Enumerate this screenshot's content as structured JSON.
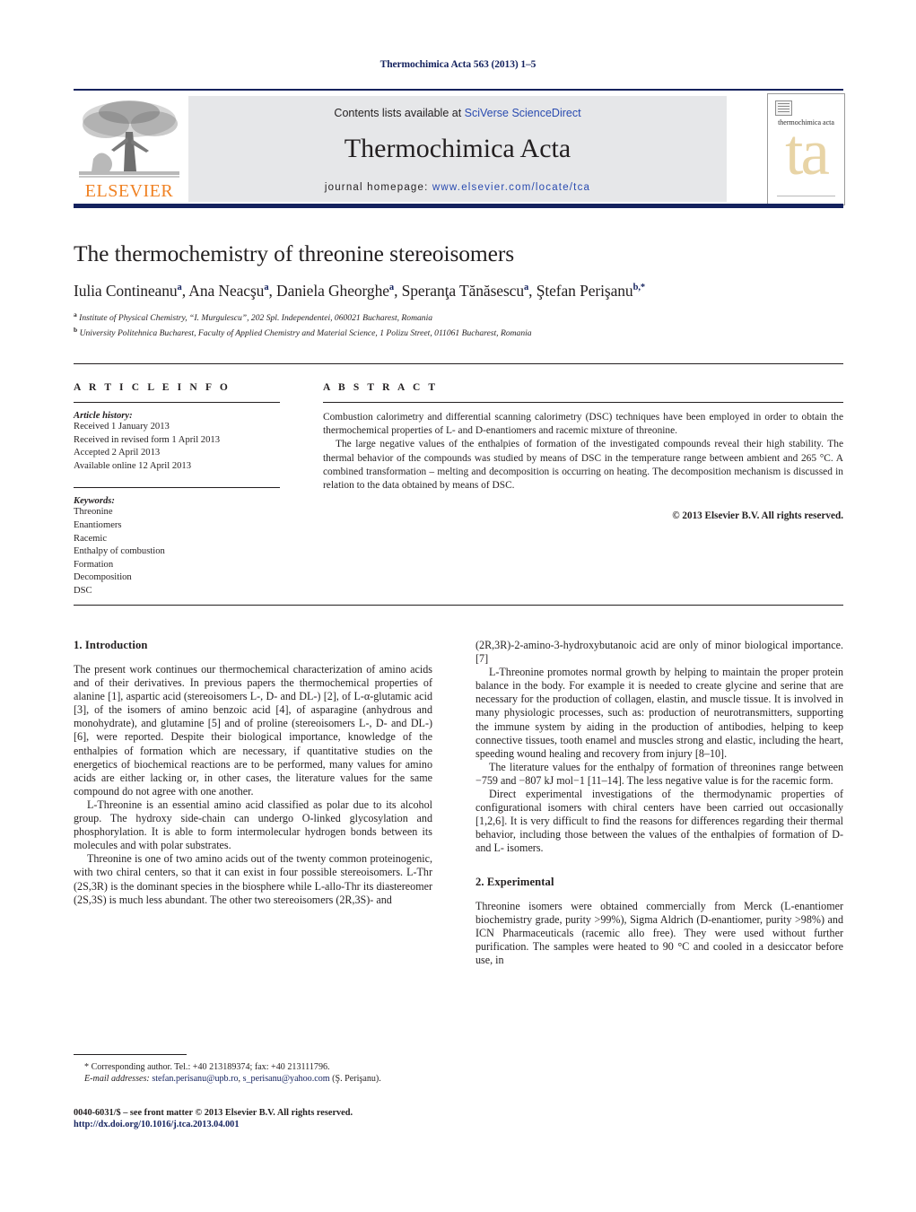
{
  "running_head": "Thermochimica Acta 563 (2013) 1–5",
  "masthead": {
    "contents_prefix": "Contents lists available at ",
    "sciencedirect_link": "SciVerse ScienceDirect",
    "journal_title": "Thermochimica Acta",
    "homepage_prefix": "journal homepage: ",
    "homepage_url": "www.elsevier.com/locate/tca",
    "publisher_logo_text": "ELSEVIER",
    "cover_journal_name": "thermochimica acta",
    "cover_monogram": "ta",
    "accent_link_color": "#2a4bb0",
    "brand_orange": "#f08224",
    "rule_navy": "#14225e"
  },
  "article": {
    "title": "The thermochemistry of threonine stereoisomers",
    "authors": [
      {
        "name": "Iulia Contineanu",
        "marks": "a",
        "sep": ", "
      },
      {
        "name": "Ana Neacşu",
        "marks": "a",
        "sep": ", "
      },
      {
        "name": "Daniela Gheorghe",
        "marks": "a",
        "sep": ", "
      },
      {
        "name": "Speranţa Tănăsescu",
        "marks": "a",
        "sep": ", "
      },
      {
        "name": "Ştefan Perişanu",
        "marks": "b,",
        "sep": ""
      }
    ],
    "affiliations": [
      {
        "mark": "a",
        "text": "Institute of Physical Chemistry, “I. Murgulescu”, 202 Spl. Independentei, 060021 Bucharest, Romania"
      },
      {
        "mark": "b",
        "text": "University Politehnica Bucharest, Faculty of Applied Chemistry and Material Science, 1 Polizu Street, 011061 Bucharest, Romania"
      }
    ]
  },
  "article_info": {
    "heading": "A R T I C L E   I N F O",
    "history_label": "Article history:",
    "history": [
      "Received 1 January 2013",
      "Received in revised form 1 April 2013",
      "Accepted 2 April 2013",
      "Available online 12 April 2013"
    ],
    "keywords_label": "Keywords:",
    "keywords": [
      "Threonine",
      "Enantiomers",
      "Racemic",
      "Enthalpy of combustion",
      "Formation",
      "Decomposition",
      "DSC"
    ]
  },
  "abstract": {
    "heading": "A B S T R A C T",
    "paragraphs": [
      "Combustion calorimetry and differential scanning calorimetry (DSC) techniques have been employed in order to obtain the thermochemical properties of L- and D-enantiomers and racemic mixture of threonine.",
      "The large negative values of the enthalpies of formation of the investigated compounds reveal their high stability. The thermal behavior of the compounds was studied by means of DSC in the temperature range between ambient and 265 °C. A combined transformation – melting and decomposition is occurring on heating. The decomposition mechanism is discussed in relation to the data obtained by means of DSC."
    ],
    "copyright": "© 2013 Elsevier B.V. All rights reserved."
  },
  "sections": {
    "introduction_heading": "1.  Introduction",
    "experimental_heading": "2.  Experimental",
    "intro_left": [
      "The present work continues our thermochemical characterization of amino acids and of their derivatives. In previous papers the thermochemical properties of alanine [1], aspartic acid (stereoisomers L-, D- and DL-) [2], of L-α-glutamic acid [3], of the isomers of amino benzoic acid [4], of asparagine (anhydrous and monohydrate), and glutamine [5] and of proline (stereoisomers L-, D- and DL-) [6], were reported. Despite their biological importance, knowledge of the enthalpies of formation which are necessary, if quantitative studies on the energetics of biochemical reactions are to be performed, many values for amino acids are either lacking or, in other cases, the literature values for the same compound do not agree with one another.",
      "L-Threonine is an essential amino acid classified as polar due to its alcohol group. The hydroxy side-chain can undergo O-linked glycosylation and phosphorylation. It is able to form intermolecular hydrogen bonds between its molecules and with polar substrates.",
      "Threonine is one of two amino acids out of the twenty common proteinogenic, with two chiral centers, so that it can exist in four possible stereoisomers. L-Thr (2S,3R) is the dominant species in the biosphere while L-allo-Thr its diastereomer (2S,3S) is much less abundant. The other two stereoisomers (2R,3S)- and"
    ],
    "intro_right": [
      "(2R,3R)-2-amino-3-hydroxybutanoic acid are only of minor biological importance.[7]",
      "L-Threonine promotes normal growth by helping to maintain the proper protein balance in the body. For example it is needed to create glycine and serine that are necessary for the production of collagen, elastin, and muscle tissue. It is involved in many physiologic processes, such as: production of neurotransmitters, supporting the immune system by aiding in the production of antibodies, helping to keep connective tissues, tooth enamel and muscles strong and elastic, including the heart, speeding wound healing and recovery from injury [8–10].",
      "The literature values for the enthalpy of formation of threonines range between −759 and −807 kJ mol−1 [11–14]. The less negative value is for the racemic form.",
      "Direct experimental investigations of the thermodynamic properties of configurational isomers with chiral centers have been carried out occasionally [1,2,6]. It is very difficult to find the reasons for differences regarding their thermal behavior, including those between the values of the enthalpies of formation of D- and L- isomers."
    ],
    "experimental_right": [
      "Threonine isomers were obtained commercially from Merck (L-enantiomer biochemistry grade, purity >99%), Sigma Aldrich (D-enantiomer, purity >98%) and ICN Pharmaceuticals (racemic allo free). They were used without further purification. The samples were heated to 90 °C and cooled in a desiccator before use, in"
    ]
  },
  "footnotes": {
    "corresponding": "* Corresponding author. Tel.: +40 213189374; fax: +40 213111796.",
    "email_label": "E-mail addresses:",
    "email_1": "stefan.perisanu@upb.ro",
    "email_sep": ", ",
    "email_2": "s_perisanu@yahoo.com",
    "email_suffix": " (Ş. Perişanu)."
  },
  "imprint": {
    "line1": "0040-6031/$ – see front matter © 2013 Elsevier B.V. All rights reserved.",
    "doi": "http://dx.doi.org/10.1016/j.tca.2013.04.001"
  }
}
